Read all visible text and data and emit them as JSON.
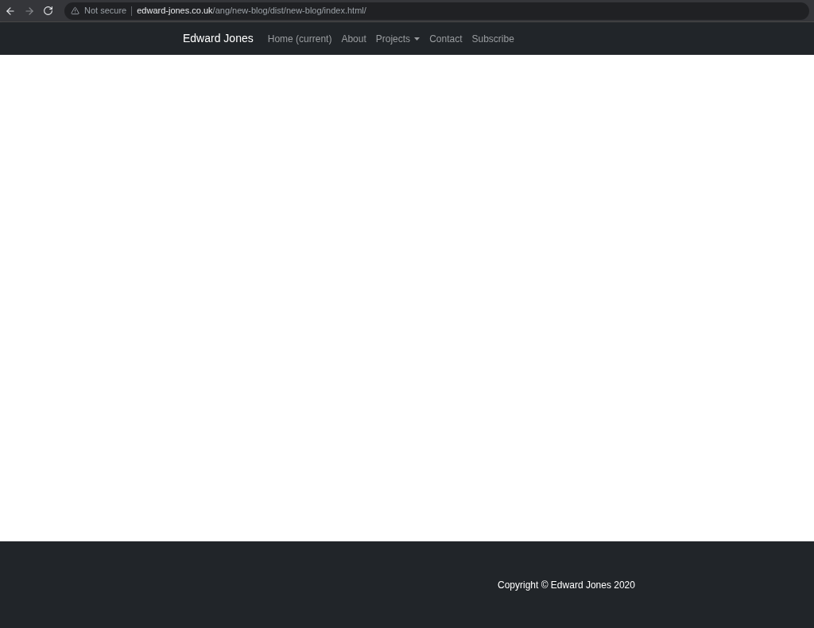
{
  "browser": {
    "security": "Not secure",
    "url_host": "edward-jones.co.uk",
    "url_path": "/ang/new-blog/dist/new-blog/index.html/"
  },
  "navbar": {
    "brand": "Edward Jones",
    "items": [
      {
        "label": "Home (current)",
        "kind": "link"
      },
      {
        "label": "About",
        "kind": "link"
      },
      {
        "label": "Projects",
        "kind": "dropdown"
      },
      {
        "label": "Contact",
        "kind": "link"
      },
      {
        "label": "Subscribe",
        "kind": "link"
      }
    ]
  },
  "footer": {
    "copyright": "Copyright © Edward Jones 2020"
  }
}
